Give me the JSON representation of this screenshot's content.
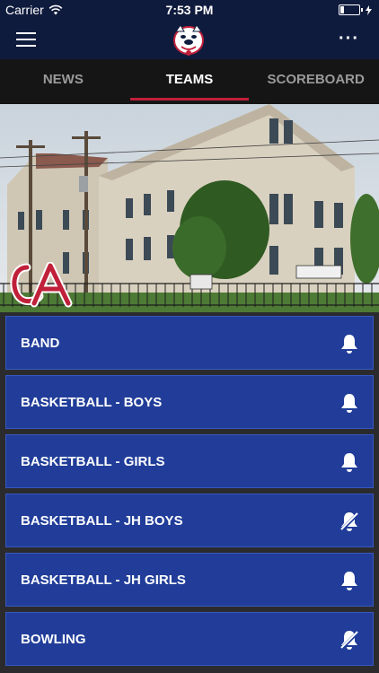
{
  "status_bar": {
    "carrier": "Carrier",
    "time": "7:53 PM",
    "icons": [
      "wifi-icon",
      "battery-icon",
      "charging-icon"
    ]
  },
  "nav": {
    "menu_icon": "hamburger-menu-icon",
    "logo": "bulldog-logo",
    "more_icon": "more-icon",
    "more_text": "···"
  },
  "tabs": [
    {
      "label": "NEWS",
      "active": false
    },
    {
      "label": "TEAMS",
      "active": true
    },
    {
      "label": "SCOREBOARD",
      "active": false
    }
  ],
  "hero": {
    "image": "school-building-photo",
    "logo_text": "CA"
  },
  "teams": [
    {
      "label": "BAND",
      "notify": "bell-icon"
    },
    {
      "label": "BASKETBALL - BOYS",
      "notify": "bell-icon"
    },
    {
      "label": "BASKETBALL - GIRLS",
      "notify": "bell-icon"
    },
    {
      "label": "BASKETBALL - JH BOYS",
      "notify": "bell-off-icon"
    },
    {
      "label": "BASKETBALL - JH GIRLS",
      "notify": "bell-icon"
    },
    {
      "label": "BOWLING",
      "notify": "bell-off-icon"
    }
  ],
  "colors": {
    "nav_bg": "#0f1b3d",
    "tab_bg": "#151515",
    "tab_active_underline": "#c0203a",
    "item_bg": "#213d99",
    "page_bg": "#2b2b2e"
  }
}
